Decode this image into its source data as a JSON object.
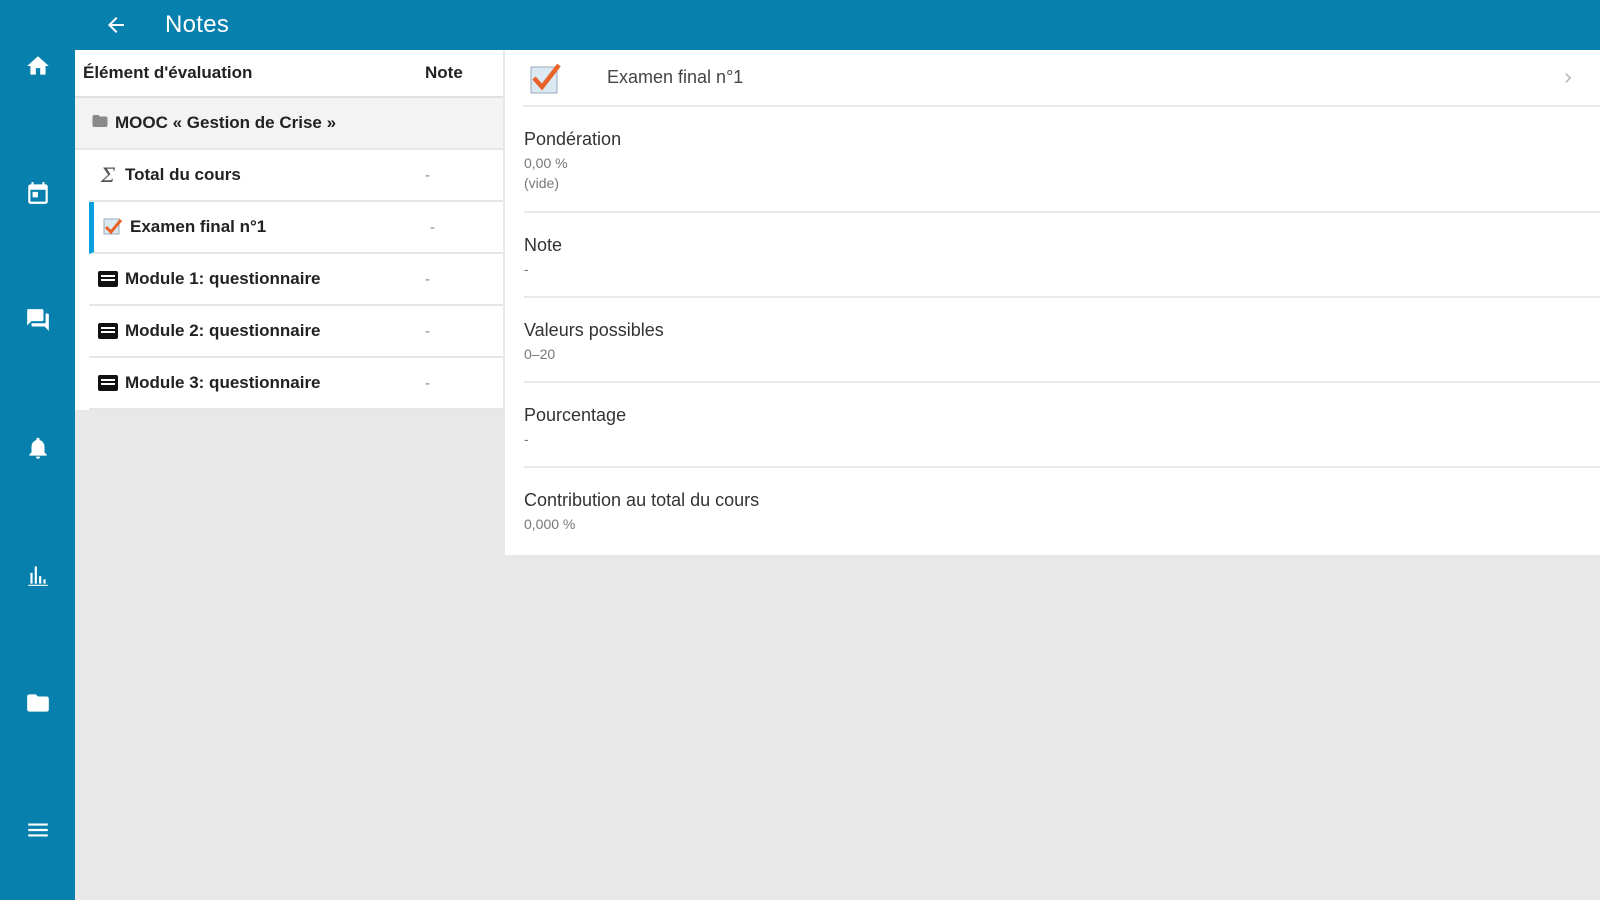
{
  "header": {
    "title": "Notes",
    "back_icon": "arrow-left-icon"
  },
  "nav_rail": [
    {
      "name": "home-icon"
    },
    {
      "name": "calendar-icon"
    },
    {
      "name": "messages-icon"
    },
    {
      "name": "notifications-icon"
    },
    {
      "name": "grades-icon"
    },
    {
      "name": "files-icon"
    },
    {
      "name": "menu-icon"
    }
  ],
  "grades": {
    "columns": {
      "item": "Élément d'évaluation",
      "grade": "Note"
    },
    "category": "MOOC « Gestion de Crise »",
    "rows": [
      {
        "label": "Total du cours",
        "grade": "-",
        "icon": "sigma-icon"
      },
      {
        "label": "Examen final n°1",
        "grade": "-",
        "icon": "checkmark-icon"
      },
      {
        "label": "Module 1: questionnaire",
        "grade": "-",
        "icon": "quiz-icon"
      },
      {
        "label": "Module 2: questionnaire",
        "grade": "-",
        "icon": "quiz-icon"
      },
      {
        "label": "Module 3: questionnaire",
        "grade": "-",
        "icon": "quiz-icon"
      }
    ]
  },
  "detail": {
    "title": "Examen final n°1",
    "fields": [
      {
        "label": "Pondération",
        "value": "0,00 %",
        "value2": "(vide)"
      },
      {
        "label": "Note",
        "value": "-"
      },
      {
        "label": "Valeurs possibles",
        "value": "0–20"
      },
      {
        "label": "Pourcentage",
        "value": "-"
      },
      {
        "label": "Contribution au total du cours",
        "value": "0,000 %"
      }
    ]
  },
  "colors": {
    "primary": "#0780ad",
    "selected_indicator": "#0aa0e0",
    "check_orange": "#e8632a"
  }
}
